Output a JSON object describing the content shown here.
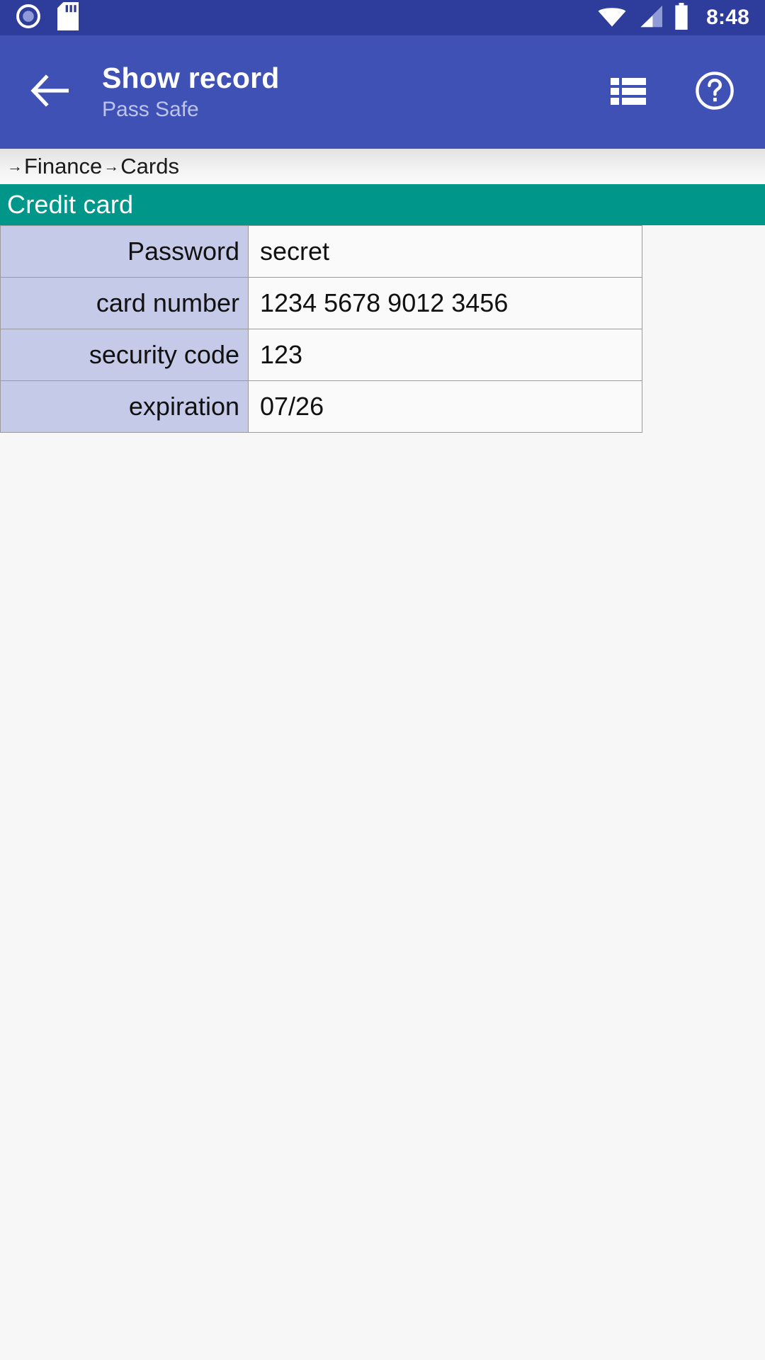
{
  "status_bar": {
    "icons": [
      "record-circle-icon",
      "sd-card-icon"
    ],
    "wifi_icon": "wifi-full-icon",
    "signal_icon": "cellular-signal-icon",
    "battery_icon": "battery-full-icon",
    "time": "8:48",
    "background_color": "#2e3d9c"
  },
  "app_bar": {
    "back_icon": "arrow-left-icon",
    "title": "Show record",
    "subtitle": "Pass Safe",
    "list_icon": "list-view-icon",
    "help_icon": "help-circle-icon",
    "background_color": "#3f51b5",
    "subtitle_color": "#bcc4ea"
  },
  "breadcrumb": {
    "separator": "→",
    "segments": [
      "Finance",
      "Cards"
    ],
    "full_text": "→ Finance → Cards"
  },
  "record": {
    "header_title": "Credit card",
    "header_color": "#00968a",
    "label_cell_color": "#c5cae9",
    "value_cell_color": "#fafafa",
    "fields": [
      {
        "label": "Password",
        "value": "secret"
      },
      {
        "label": "card number",
        "value": "1234 5678 9012 3456"
      },
      {
        "label": "security code",
        "value": "123"
      },
      {
        "label": "expiration",
        "value": "07/26"
      }
    ]
  }
}
